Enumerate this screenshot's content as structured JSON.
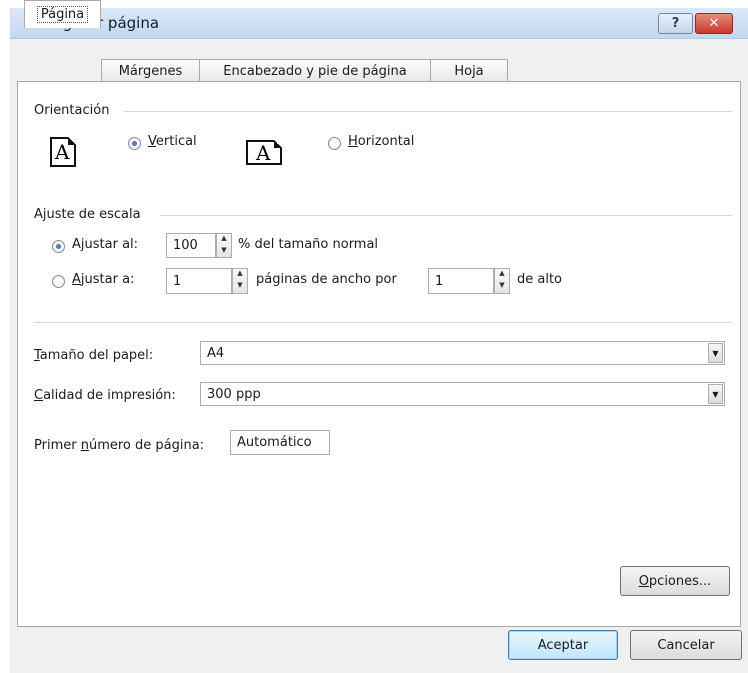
{
  "window": {
    "title": "Configurar página",
    "help_glyph": "?",
    "close_glyph": "✕"
  },
  "tabs": [
    {
      "label": "Página",
      "active": true
    },
    {
      "label": "Márgenes"
    },
    {
      "label": "Encabezado y pie de página"
    },
    {
      "label": "Hoja"
    }
  ],
  "orientation": {
    "group_label": "Orientación",
    "vertical": {
      "label_pre": "",
      "label_key": "V",
      "label_post": "ertical",
      "checked": true
    },
    "horizontal": {
      "label_pre": "",
      "label_key": "H",
      "label_post": "orizontal",
      "checked": false
    },
    "icon_letter": "A"
  },
  "scaling": {
    "group_label": "Ajuste de escala",
    "adjust_to": {
      "label_pre": "A",
      "label_key": "j",
      "label_post": "ustar al:",
      "value": "100",
      "suffix": "% del tamaño normal",
      "checked": true
    },
    "fit_to": {
      "label_pre": "",
      "label_key": "A",
      "label_post": "justar a:",
      "wide_value": "1",
      "wide_suffix": "páginas de ancho por",
      "tall_value": "1",
      "tall_suffix": "de alto",
      "checked": false
    }
  },
  "paper": {
    "size_label_key": "T",
    "size_label_post": "amaño del papel:",
    "size_value": "A4",
    "quality_label_key": "C",
    "quality_label_post": "alidad de impresión:",
    "quality_value": "300 ppp",
    "first_page_pre": "Primer ",
    "first_page_key": "n",
    "first_page_post": "úmero de página:",
    "first_page_value": "Automático"
  },
  "buttons": {
    "options_key": "O",
    "options_post": "pciones...",
    "ok": "Aceptar",
    "cancel": "Cancelar"
  },
  "icons": [
    "help-icon",
    "close-icon",
    "page-portrait-icon",
    "page-landscape-icon",
    "spin-up-icon",
    "spin-down-icon",
    "dropdown-arrow-icon"
  ]
}
